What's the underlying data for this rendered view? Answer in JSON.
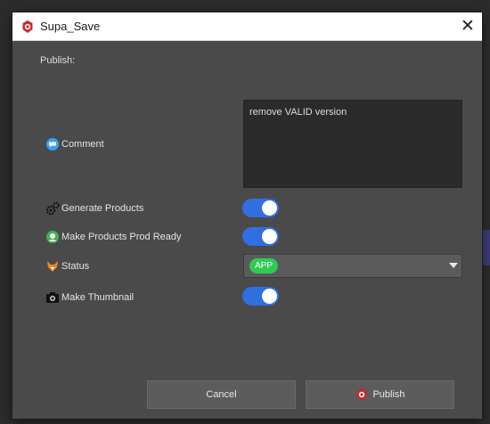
{
  "window": {
    "title": "Supa_Save",
    "close_glyph": "✕",
    "app_icon": "supa-save-logo-icon"
  },
  "form": {
    "section_title": "Publish:",
    "comment": {
      "label": "Comment",
      "icon": "comment-bubble-icon",
      "value": "remove VALID version"
    },
    "generate_products": {
      "label": "Generate Products",
      "icon": "gears-icon",
      "enabled": true
    },
    "prod_ready": {
      "label": "Make Products Prod Ready",
      "icon": "green-badge-icon",
      "enabled": true
    },
    "status": {
      "label": "Status",
      "icon": "fox-icon",
      "value": "APP",
      "value_color": "#2ecc52"
    },
    "thumbnail": {
      "label": "Make Thumbnail",
      "icon": "camera-icon",
      "enabled": true
    }
  },
  "buttons": {
    "cancel": "Cancel",
    "publish": "Publish",
    "publish_icon": "supa-save-logo-icon"
  },
  "colors": {
    "toggle_on": "#2f6fe0",
    "dialog_bg": "#4a4a4a"
  }
}
